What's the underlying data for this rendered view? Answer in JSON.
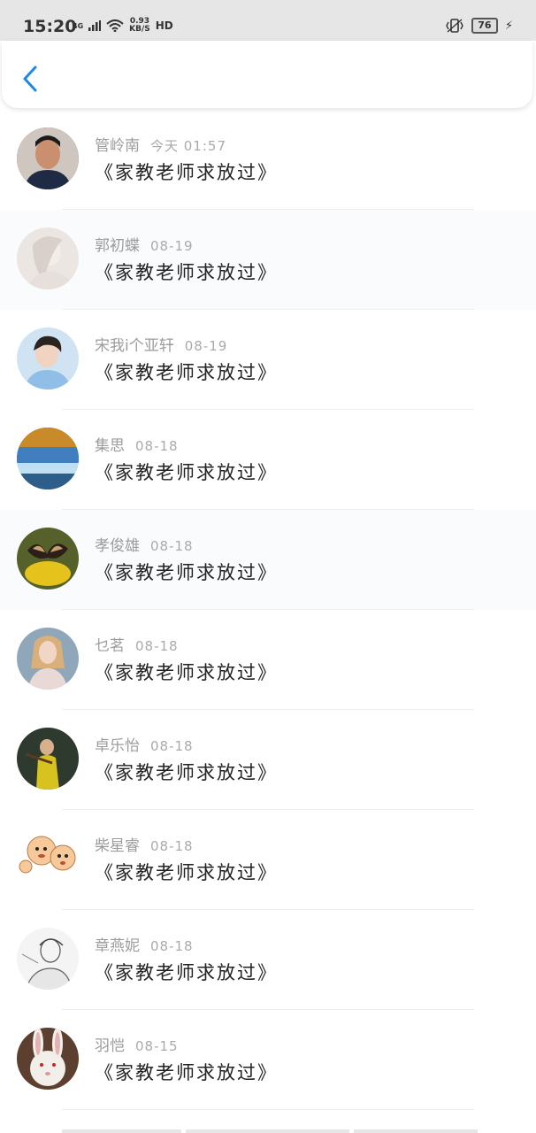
{
  "status_bar": {
    "time": "15:20",
    "network": "4G",
    "speed_value": "0.93",
    "speed_unit": "KB/S",
    "hd": "HD",
    "battery": "76"
  },
  "header": {
    "back_icon": "chevron-left-icon",
    "accent_color": "#1e88e5"
  },
  "messages": [
    {
      "name": "管岭南",
      "date": "今天 01:57",
      "text": "《家教老师求放过》",
      "avatar_color": "#5a4a44"
    },
    {
      "name": "郭初蝶",
      "date": "08-19",
      "text": "《家教老师求放过》",
      "avatar_color": "#ddd5cf"
    },
    {
      "name": "宋我i个亚轩",
      "date": "08-19",
      "text": "《家教老师求放过》",
      "avatar_color": "#9fc7e6"
    },
    {
      "name": "集思",
      "date": "08-18",
      "text": "《家教老师求放过》",
      "avatar_color": "#4f7fb0"
    },
    {
      "name": "孝俊雄",
      "date": "08-18",
      "text": "《家教老师求放过》",
      "avatar_color": "#8a7a2c"
    },
    {
      "name": "乜茗",
      "date": "08-18",
      "text": "《家教老师求放过》",
      "avatar_color": "#b9a6a0"
    },
    {
      "name": "卓乐怡",
      "date": "08-18",
      "text": "《家教老师求放过》",
      "avatar_color": "#3c4a3c"
    },
    {
      "name": "柴星睿",
      "date": "08-18",
      "text": "《家教老师求放过》",
      "avatar_color": "#f2c79c"
    },
    {
      "name": "章燕妮",
      "date": "08-18",
      "text": "《家教老师求放过》",
      "avatar_color": "#d9d9d9"
    },
    {
      "name": "羽恺",
      "date": "08-15",
      "text": "《家教老师求放过》",
      "avatar_color": "#6b4a38"
    }
  ]
}
